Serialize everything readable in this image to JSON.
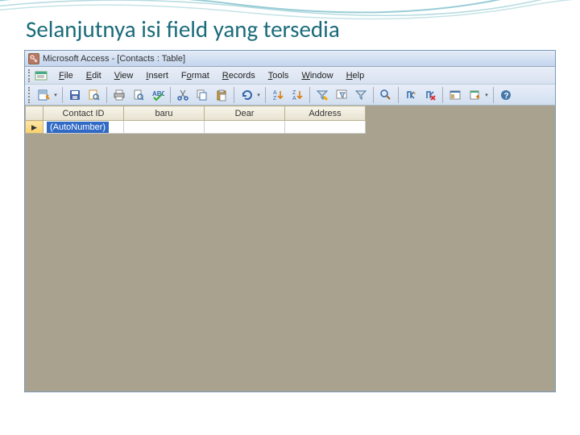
{
  "slide": {
    "title": "Selanjutnya isi field yang tersedia"
  },
  "window": {
    "title": "Microsoft Access - [Contacts : Table]"
  },
  "menu": {
    "file": "File",
    "edit": "Edit",
    "view": "View",
    "insert": "Insert",
    "format": "Format",
    "records": "Records",
    "tools": "Tools",
    "window": "Window",
    "help": "Help"
  },
  "columns": [
    "Contact ID",
    "baru",
    "Dear",
    "Address"
  ],
  "row": {
    "indicator": "▶",
    "cell0": "(AutoNumber)",
    "cell1": "",
    "cell2": "",
    "cell3": ""
  },
  "toolbar_icons": [
    "design-view",
    "datasheet-view",
    "save",
    "search",
    "print",
    "print-preview",
    "spelling",
    "cut",
    "copy",
    "paste",
    "undo",
    "sort-ascending",
    "sort-descending",
    "filter-by-selection",
    "filter-by-form",
    "apply-filter",
    "find",
    "new-record",
    "delete-record",
    "database-window",
    "new-object",
    "help"
  ]
}
